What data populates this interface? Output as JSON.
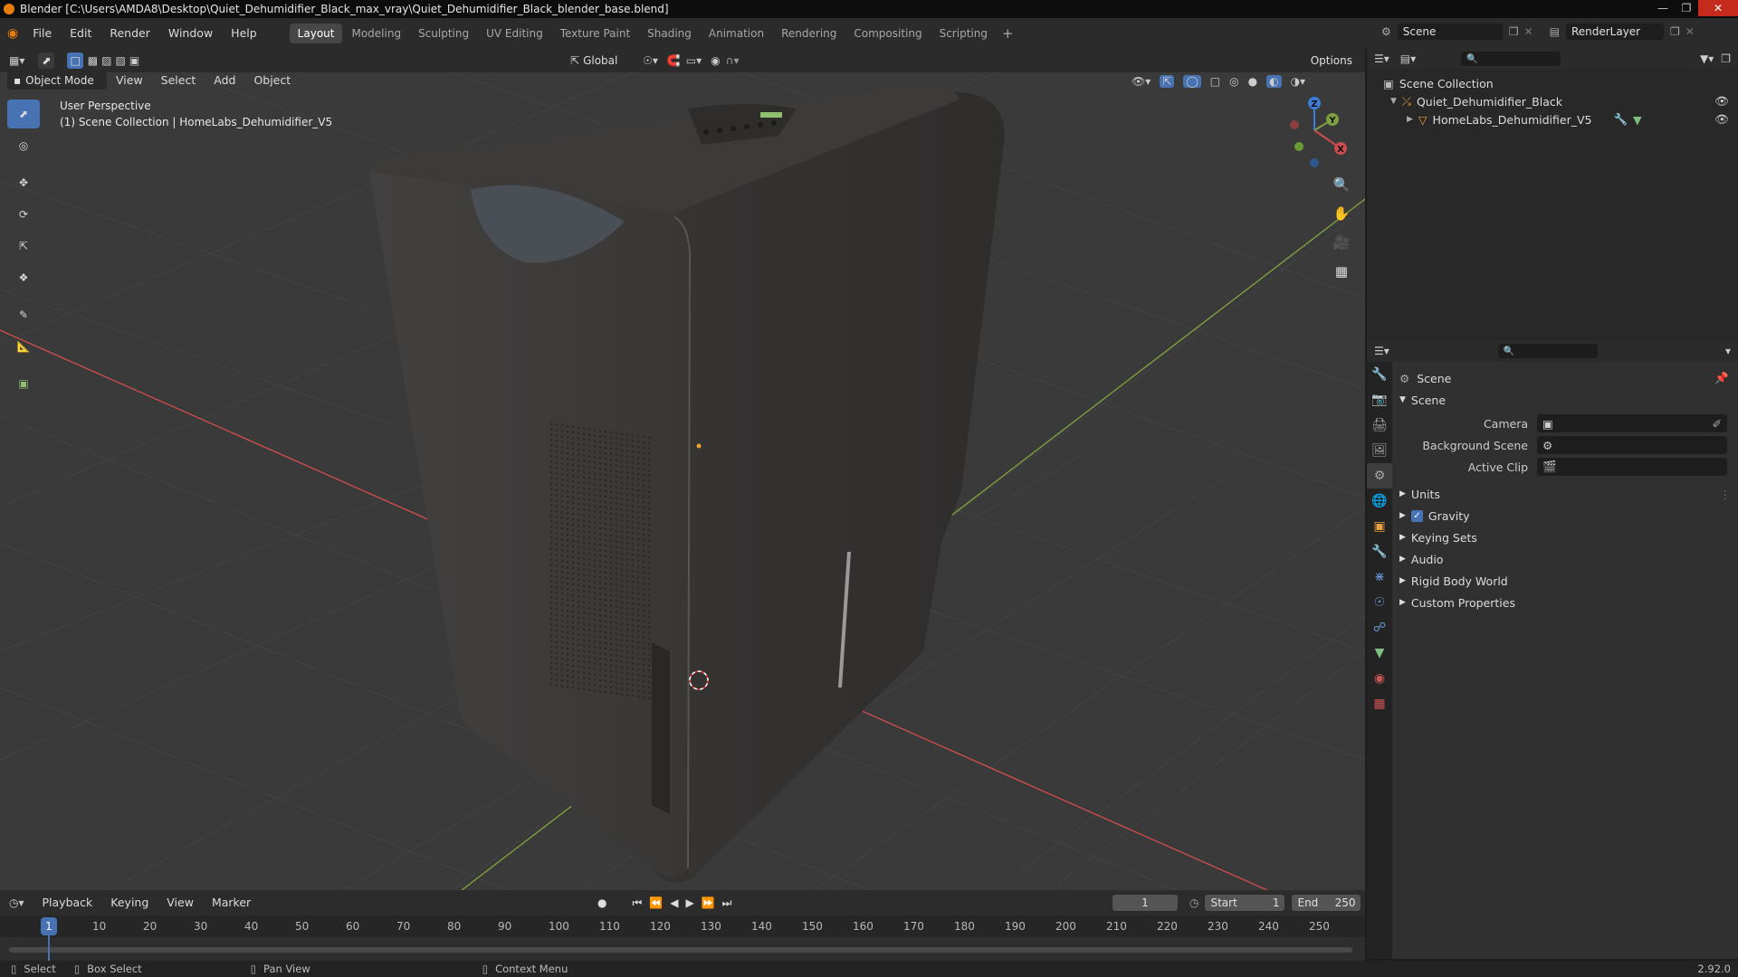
{
  "window": {
    "title": "Blender [C:\\Users\\AMDA8\\Desktop\\Quiet_Dehumidifier_Black_max_vray\\Quiet_Dehumidifier_Black_blender_base.blend]"
  },
  "menu": [
    "File",
    "Edit",
    "Render",
    "Window",
    "Help"
  ],
  "workspaces": [
    "Layout",
    "Modeling",
    "Sculpting",
    "UV Editing",
    "Texture Paint",
    "Shading",
    "Animation",
    "Rendering",
    "Compositing",
    "Scripting"
  ],
  "active_workspace": "Layout",
  "scene_selector": {
    "scene": "Scene",
    "render_layer": "RenderLayer"
  },
  "viewport_header": {
    "mode": "Object Mode",
    "menus": [
      "View",
      "Select",
      "Add",
      "Object"
    ],
    "transform_orientation": "Global",
    "options_label": "Options"
  },
  "viewport": {
    "perspective_label": "User Perspective",
    "collection_label": "(1) Scene Collection | HomeLabs_Dehumidifier_V5",
    "gizmo_axes": {
      "x": "X",
      "y": "Y",
      "z": "Z"
    }
  },
  "outliner": {
    "root": "Scene Collection",
    "items": [
      {
        "label": "Quiet_Dehumidifier_Black"
      },
      {
        "label": "HomeLabs_Dehumidifier_V5"
      }
    ]
  },
  "properties": {
    "context_label": "Scene",
    "panel_title": "Scene",
    "fields": [
      {
        "label": "Camera",
        "value": ""
      },
      {
        "label": "Background Scene",
        "value": ""
      },
      {
        "label": "Active Clip",
        "value": ""
      }
    ],
    "subpanels": [
      "Units",
      "Gravity",
      "Keying Sets",
      "Audio",
      "Rigid Body World",
      "Custom Properties"
    ],
    "gravity_checked": true
  },
  "timeline": {
    "menus": [
      "Playback",
      "Keying",
      "View",
      "Marker"
    ],
    "current_frame": "1",
    "start_label": "Start",
    "start_value": "1",
    "end_label": "End",
    "end_value": "250",
    "playhead_frame": "1",
    "ticks": [
      "10",
      "20",
      "30",
      "40",
      "50",
      "60",
      "70",
      "80",
      "90",
      "100",
      "110",
      "120",
      "130",
      "140",
      "150",
      "160",
      "170",
      "180",
      "190",
      "200",
      "210",
      "220",
      "230",
      "240",
      "250"
    ]
  },
  "statusbar": {
    "hints": [
      "Select",
      "Box Select",
      "Pan View",
      "Context Menu"
    ],
    "version": "2.92.0"
  },
  "colors": {
    "accent": "#4772b3",
    "x_axis": "#c84d4d",
    "y_axis": "#7ea03f",
    "z_axis": "#3f7bd6",
    "object_body": "#3c3a38"
  }
}
